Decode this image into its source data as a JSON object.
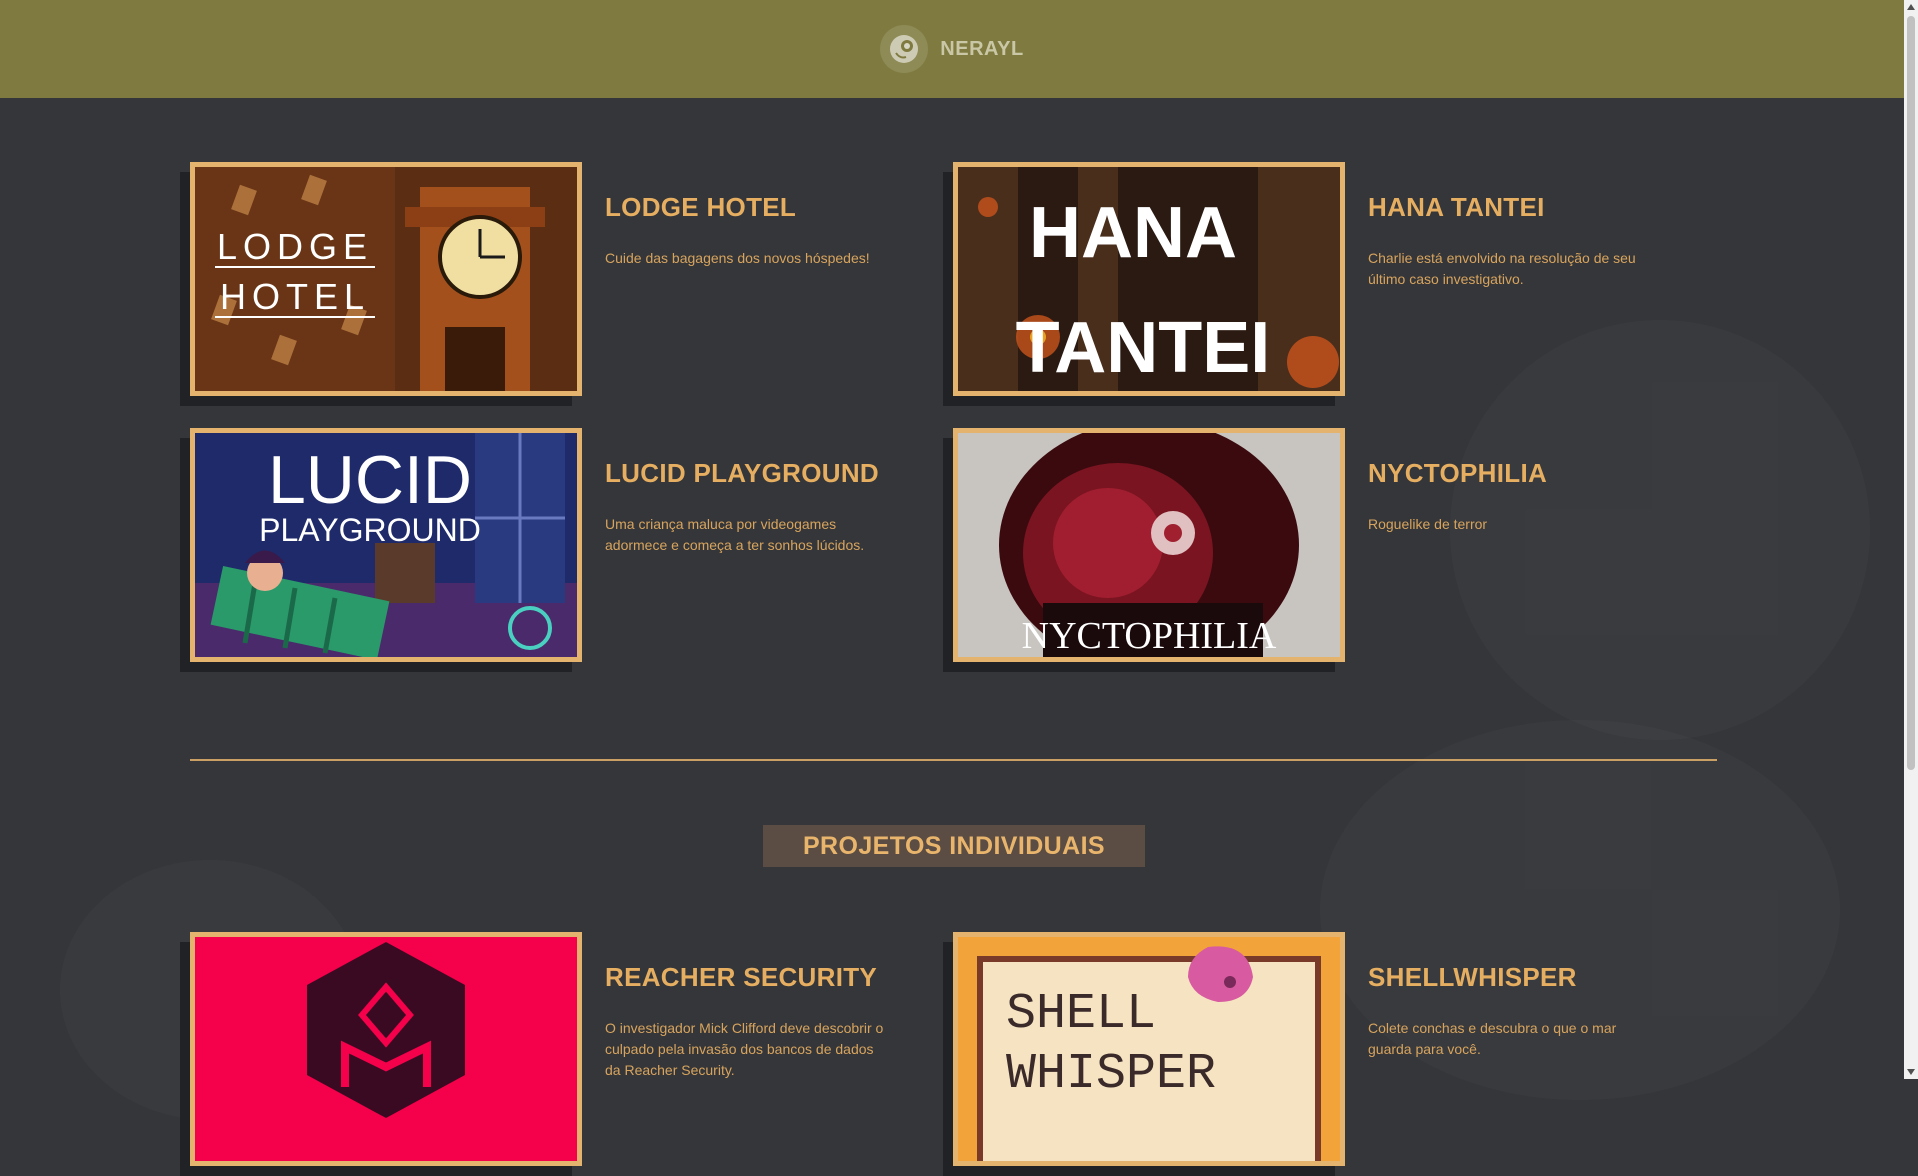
{
  "header": {
    "brand": "NERAYL"
  },
  "projects": [
    {
      "title": "LODGE HOTEL",
      "description": "Cuide das bagagens dos novos hóspedes!",
      "art_text_1": "LODGE",
      "art_text_2": "HOTEL"
    },
    {
      "title": "HANA TANTEI",
      "description": "Charlie está envolvido na resolução de seu último caso investigativo.",
      "art_text_1": "HANA",
      "art_text_2": "TANTEI"
    },
    {
      "title": "LUCID PLAYGROUND",
      "description": "Uma criança maluca por videogames adormece e começa a ter sonhos lúcidos.",
      "art_text_1": "LUCID",
      "art_text_2": "PLAYGROUND"
    },
    {
      "title": "NYCTOPHILIA",
      "description": "Roguelike de terror",
      "art_text_1": "NYCTOPHILIA"
    }
  ],
  "individual_section": {
    "label": "PROJETOS INDIVIDUAIS"
  },
  "individual_projects": [
    {
      "title": "REACHER SECURITY",
      "description": "O investigador Mick Clifford deve descobrir o culpado pela invasão dos bancos de dados da Reacher Security."
    },
    {
      "title": "SHELLWHISPER",
      "description": "Colete conchas e descubra o que o mar guarda para você.",
      "art_text_1": "SHELL",
      "art_text_2": "WHISPER"
    }
  ],
  "colors": {
    "header": "#7f7b40",
    "background": "#34363a",
    "accent": "#e6ae60",
    "frame": "#e4b46f"
  }
}
